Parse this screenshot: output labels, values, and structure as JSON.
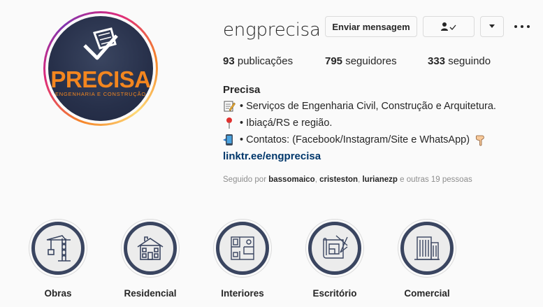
{
  "profile": {
    "username": "engprecisa",
    "avatar": {
      "brand": "PRECISA",
      "tagline": "ENGENHARIA E CONSTRUÇÃO"
    }
  },
  "actions": {
    "message_label": "Enviar mensagem",
    "follow_icon": "person-check-icon",
    "more_icon": "chevron-down-icon",
    "options_icon": "more-options-icon"
  },
  "stats": {
    "posts_count": "93",
    "posts_label": "publicações",
    "followers_count": "795",
    "followers_label": "seguidores",
    "following_count": "333",
    "following_label": "seguindo"
  },
  "bio": {
    "name": "Precisa",
    "line1": "• Serviços de Engenharia Civil, Construção e Arquitetura.",
    "line2": "• Ibiaçá/RS e região.",
    "line3": "• Contatos: (Facebook/Instagram/Site e WhatsApp)",
    "link": "linktr.ee/engprecisa"
  },
  "followed_by": {
    "prefix": "Seguido por",
    "user1": "bassomaico",
    "user2": "cristeston",
    "user3": "lurianezp",
    "suffix": "e outras 19 pessoas"
  },
  "highlights": [
    {
      "label": "Obras",
      "icon": "crane-icon"
    },
    {
      "label": "Residencial",
      "icon": "house-icon"
    },
    {
      "label": "Interiores",
      "icon": "floor-plan-icon"
    },
    {
      "label": "Escritório",
      "icon": "blueprint-icon"
    },
    {
      "label": "Comercial",
      "icon": "building-icon"
    }
  ],
  "colors": {
    "brand_orange": "#f3861f",
    "link": "#00376b",
    "highlight_ring": "#3a4560"
  }
}
